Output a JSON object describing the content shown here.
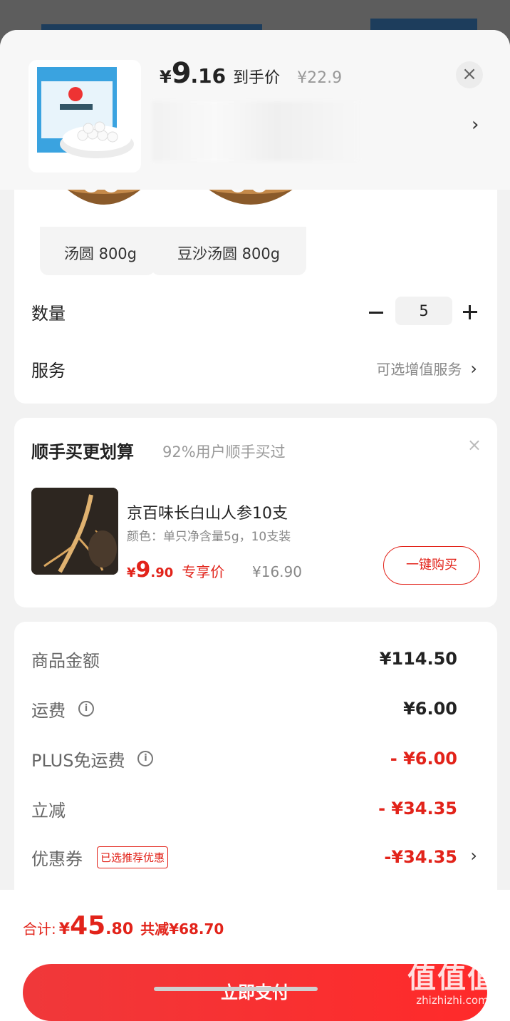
{
  "header": {
    "yen": "¥",
    "price_int": "9",
    "price_dec": ".16",
    "price_label": "到手价",
    "original_price": "¥22.9",
    "close": "×",
    "chevron": "›"
  },
  "variants": [
    {
      "label": "汤圆 800g"
    },
    {
      "label": "豆沙汤圆 800g"
    }
  ],
  "quantity": {
    "label": "数量",
    "value": "5"
  },
  "service": {
    "label": "服务",
    "value": "可选增值服务",
    "chevron": "›"
  },
  "recommend": {
    "title": "顺手买更划算",
    "subtitle": "92%用户顺手买过",
    "close": "×",
    "product_name": "京百味长白山人参10支",
    "spec": "颜色：单只净含量5g，10支装",
    "yen": "¥",
    "price_int": "9",
    "price_dec": ".90",
    "price_tag": "专享价",
    "original_price": "¥16.90",
    "buy_label": "一键购买"
  },
  "fees": {
    "goods": {
      "label": "商品金额",
      "value": "¥114.50"
    },
    "shipping": {
      "label": "运费",
      "value": "¥6.00"
    },
    "plus_free": {
      "label": "PLUS免运费",
      "value": "- ¥6.00"
    },
    "instant_off": {
      "label": "立减",
      "value": "- ¥34.35"
    },
    "coupon": {
      "label": "优惠券",
      "tag": "已选推荐优惠",
      "value": "-¥34.35",
      "chevron": "›"
    }
  },
  "footer": {
    "total_label": "合计:",
    "yen": "¥",
    "total_int": "45",
    "total_dec": ".80",
    "discount": "共减¥68.70",
    "pay_label": "立即支付"
  },
  "watermark": {
    "big": "值值值",
    "small": "zhizhizhi.com"
  },
  "colors": {
    "accent": "#e2231a",
    "background": "#f2f2f2"
  }
}
